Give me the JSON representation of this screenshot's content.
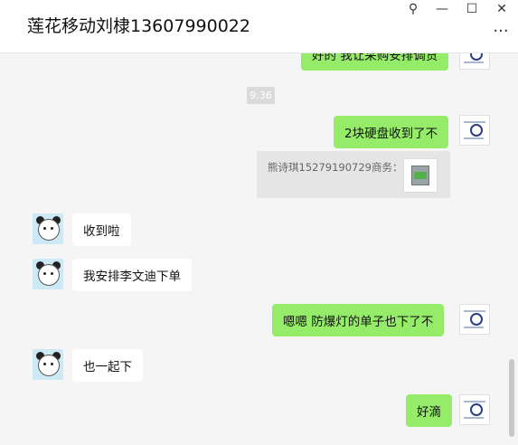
{
  "window": {
    "title": "莲花移动刘棣13607990022",
    "controls": {
      "pin": "⚲",
      "minimize": "—",
      "maximize": "☐",
      "close": "✕",
      "more": "···"
    }
  },
  "chat": {
    "messages": [
      {
        "type": "sent",
        "text": "好的 我让采购安排调货"
      },
      {
        "type": "time",
        "text": "9:36"
      },
      {
        "type": "sent",
        "text": "2块硬盘收到了不"
      },
      {
        "type": "quote",
        "text": "熊诗琪15279190729商务："
      },
      {
        "type": "received",
        "text": "收到啦"
      },
      {
        "type": "received",
        "text": "我安排李文迪下单"
      },
      {
        "type": "sent",
        "text": "嗯嗯  防爆灯的单子也下了不"
      },
      {
        "type": "received",
        "text": "也一起下"
      },
      {
        "type": "sent",
        "text": "好滴"
      }
    ]
  }
}
